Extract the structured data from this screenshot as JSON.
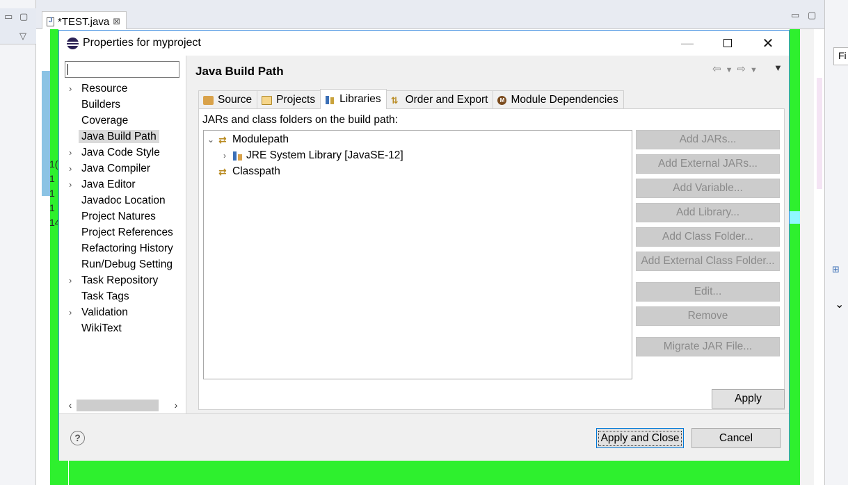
{
  "ide": {
    "editor_tab": "*TEST.java",
    "editor_tab_close": "⊠",
    "line_numbers": [
      "1(",
      "1",
      "1",
      "1",
      "14"
    ],
    "find_box": "Fi"
  },
  "dialog": {
    "title": "Properties for myproject",
    "filter_value": "",
    "nav_items": [
      {
        "label": "Resource",
        "expandable": true
      },
      {
        "label": "Builders",
        "expandable": false
      },
      {
        "label": "Coverage",
        "expandable": false
      },
      {
        "label": "Java Build Path",
        "expandable": false,
        "selected": true
      },
      {
        "label": "Java Code Style",
        "expandable": true
      },
      {
        "label": "Java Compiler",
        "expandable": true
      },
      {
        "label": "Java Editor",
        "expandable": true
      },
      {
        "label": "Javadoc Location",
        "expandable": false
      },
      {
        "label": "Project Natures",
        "expandable": false
      },
      {
        "label": "Project References",
        "expandable": false
      },
      {
        "label": "Refactoring History",
        "expandable": false
      },
      {
        "label": "Run/Debug Setting",
        "expandable": false
      },
      {
        "label": "Task Repository",
        "expandable": true
      },
      {
        "label": "Task Tags",
        "expandable": false
      },
      {
        "label": "Validation",
        "expandable": true
      },
      {
        "label": "WikiText",
        "expandable": false
      }
    ],
    "page_title": "Java Build Path",
    "tabs": [
      {
        "label": "Source",
        "icon": "source-icon"
      },
      {
        "label": "Projects",
        "icon": "projects-icon"
      },
      {
        "label": "Libraries",
        "icon": "libraries-icon",
        "active": true
      },
      {
        "label": "Order and Export",
        "icon": "order-export-icon"
      },
      {
        "label": "Module Dependencies",
        "icon": "module-icon"
      }
    ],
    "panel_label": "JARs and class folders on the build path:",
    "build_path_tree": {
      "modulepath": "Modulepath",
      "jre": "JRE System Library [JavaSE-12]",
      "classpath": "Classpath"
    },
    "buttons": {
      "add_jars": "Add JARs...",
      "add_external_jars": "Add External JARs...",
      "add_variable": "Add Variable...",
      "add_library": "Add Library...",
      "add_class_folder": "Add Class Folder...",
      "add_external_class_folder": "Add External Class Folder...",
      "edit": "Edit...",
      "remove": "Remove",
      "migrate_jar": "Migrate JAR File..."
    },
    "apply": "Apply",
    "apply_and_close": "Apply and Close",
    "cancel": "Cancel",
    "help": "?"
  },
  "colors": {
    "accent": "#0078d7",
    "highlight_green": "#2ef02e",
    "selection": "#dadada"
  }
}
